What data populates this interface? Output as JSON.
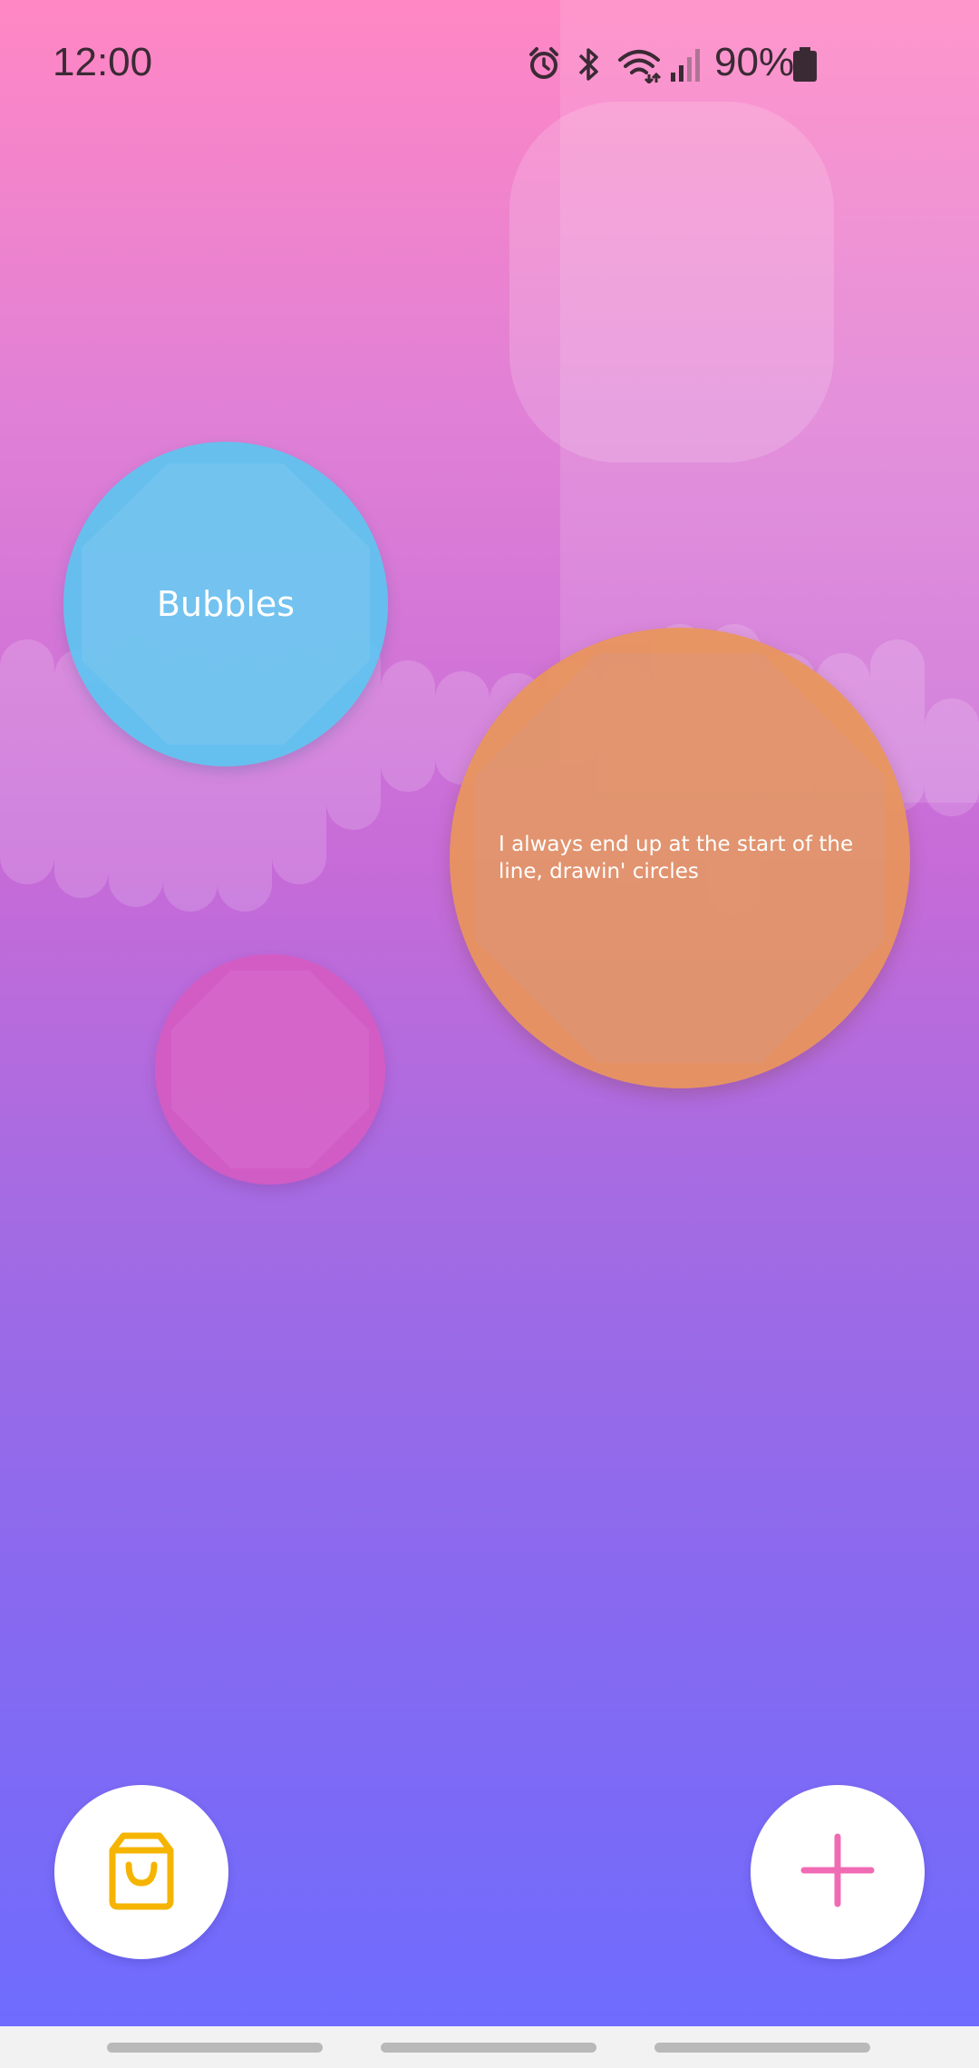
{
  "status_bar": {
    "time": "12:00",
    "battery_percent": "90%",
    "icons": [
      "alarm-icon",
      "bluetooth-icon",
      "wifi-icon",
      "signal-icon",
      "battery-icon"
    ]
  },
  "bubbles": {
    "blue": {
      "label": "Bubbles",
      "color": "#5ec4f0"
    },
    "orange": {
      "label": "I always end up at the start of the line, drawin' circles",
      "color": "#e8945a"
    },
    "pink": {
      "label": "",
      "color": "#d65ac0"
    }
  },
  "actions": {
    "shop_icon": "shopping-bag-icon",
    "add_icon": "plus-icon",
    "shop_icon_color": "#f5b400",
    "add_icon_color": "#f06bb4"
  },
  "theme": {
    "gradient_top": "#ff87c4",
    "gradient_bottom": "#6c6cff"
  }
}
